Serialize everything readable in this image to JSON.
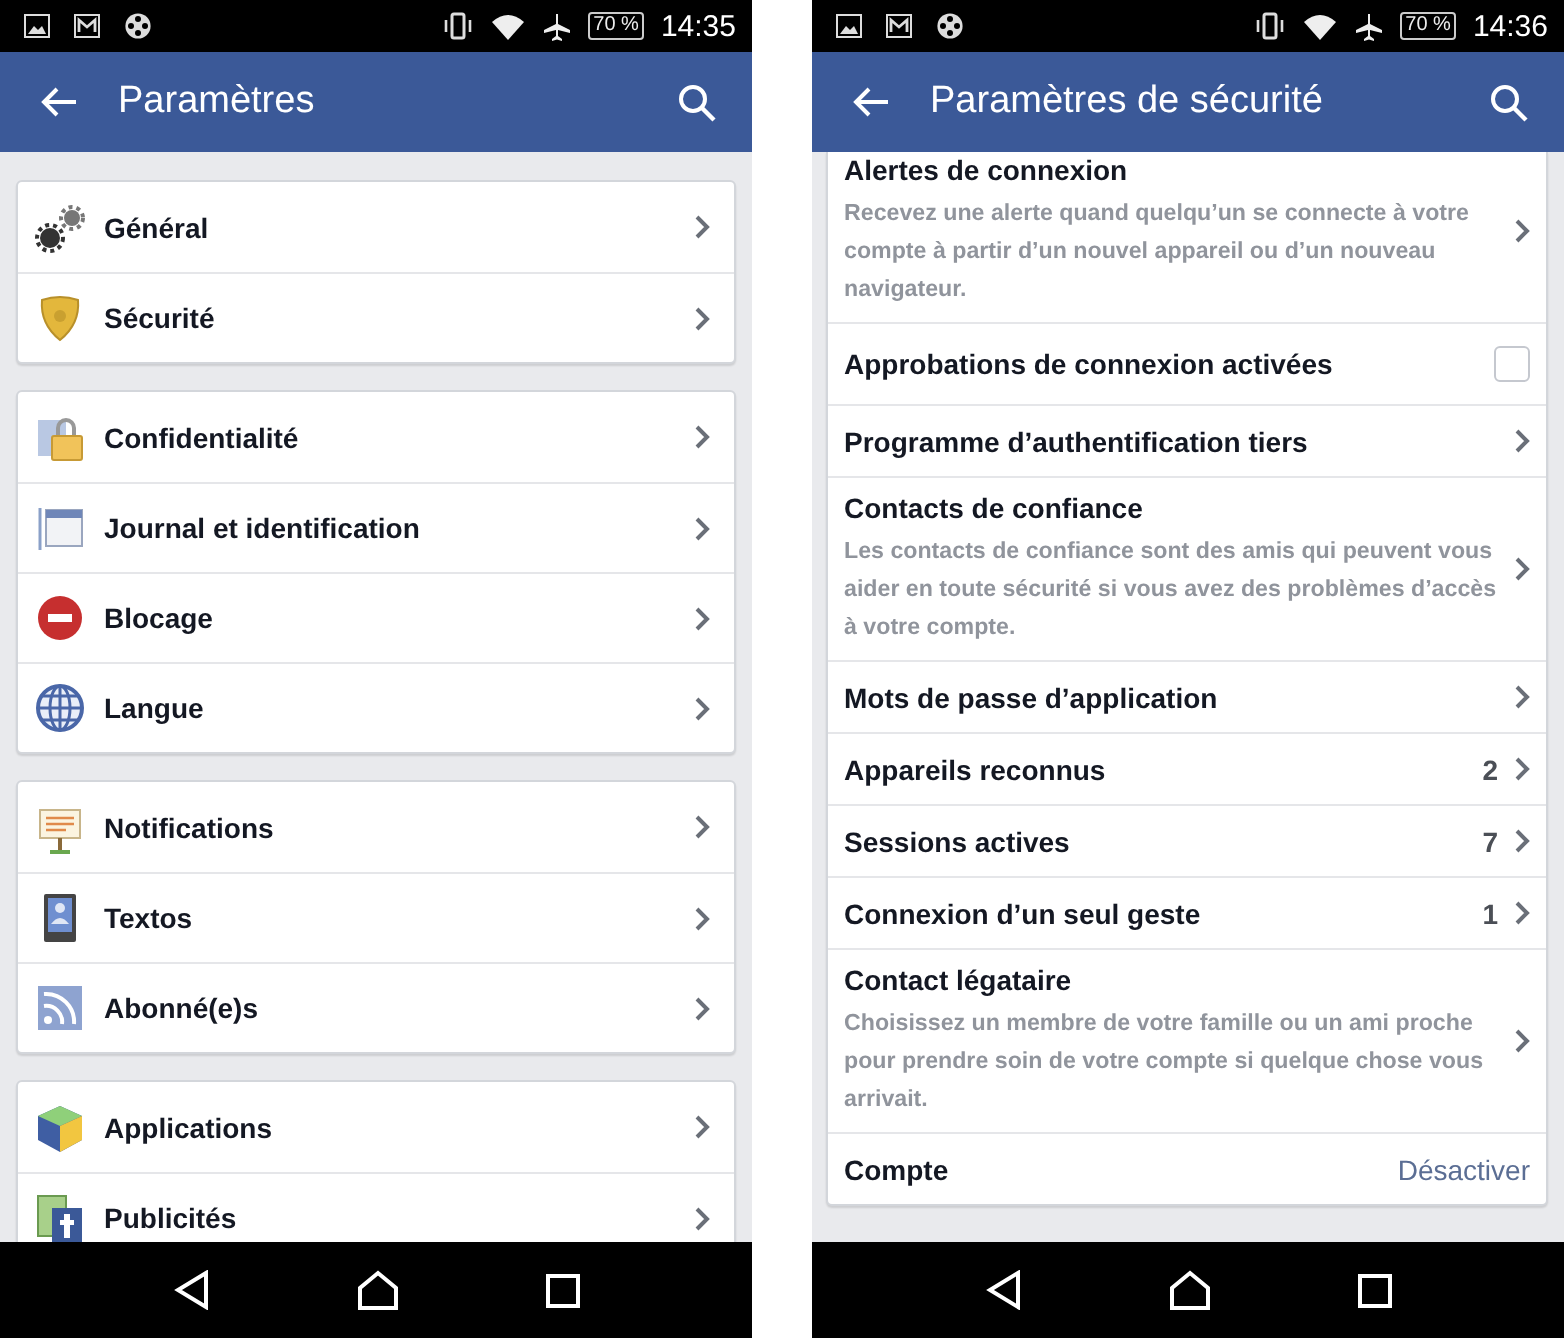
{
  "screens": [
    {
      "status_bar": {
        "battery": "70 %",
        "time": "14:35"
      },
      "app_bar": {
        "title": "Paramètres"
      },
      "groups": [
        {
          "items": [
            {
              "label": "Général"
            },
            {
              "label": "Sécurité"
            }
          ]
        },
        {
          "items": [
            {
              "label": "Confidentialité"
            },
            {
              "label": "Journal et identification"
            },
            {
              "label": "Blocage"
            },
            {
              "label": "Langue"
            }
          ]
        },
        {
          "items": [
            {
              "label": "Notifications"
            },
            {
              "label": "Textos"
            },
            {
              "label": "Abonné(e)s"
            }
          ]
        },
        {
          "items": [
            {
              "label": "Applications"
            },
            {
              "label": "Publicités"
            }
          ]
        }
      ]
    },
    {
      "status_bar": {
        "battery": "70 %",
        "time": "14:36"
      },
      "app_bar": {
        "title": "Paramètres de sécurité"
      },
      "rows": [
        {
          "kind": "nav",
          "title": "Alertes de connexion",
          "description": "Recevez une alerte quand quelqu’un se connecte à votre compte à partir d’un nouvel appareil ou d’un nouveau navigateur."
        },
        {
          "kind": "checkbox",
          "title": "Approbations de connexion activées",
          "checked": false
        },
        {
          "kind": "nav",
          "title": "Programme d’authentification tiers"
        },
        {
          "kind": "nav",
          "title": "Contacts de confiance",
          "description": "Les contacts de confiance sont des amis qui peuvent vous aider en toute sécurité si vous avez des problèmes d’accès à votre compte."
        },
        {
          "kind": "nav",
          "title": "Mots de passe d’application"
        },
        {
          "kind": "nav",
          "title": "Appareils reconnus",
          "count": "2"
        },
        {
          "kind": "nav",
          "title": "Sessions actives",
          "count": "7"
        },
        {
          "kind": "nav",
          "title": "Connexion d’un seul geste",
          "count": "1"
        },
        {
          "kind": "nav",
          "title": "Contact légataire",
          "description": "Choisissez un membre de votre famille ou un ami proche pour prendre soin de votre compte si quelque chose vous arrivait."
        },
        {
          "kind": "action",
          "title": "Compte",
          "action": "Désactiver"
        }
      ]
    }
  ]
}
